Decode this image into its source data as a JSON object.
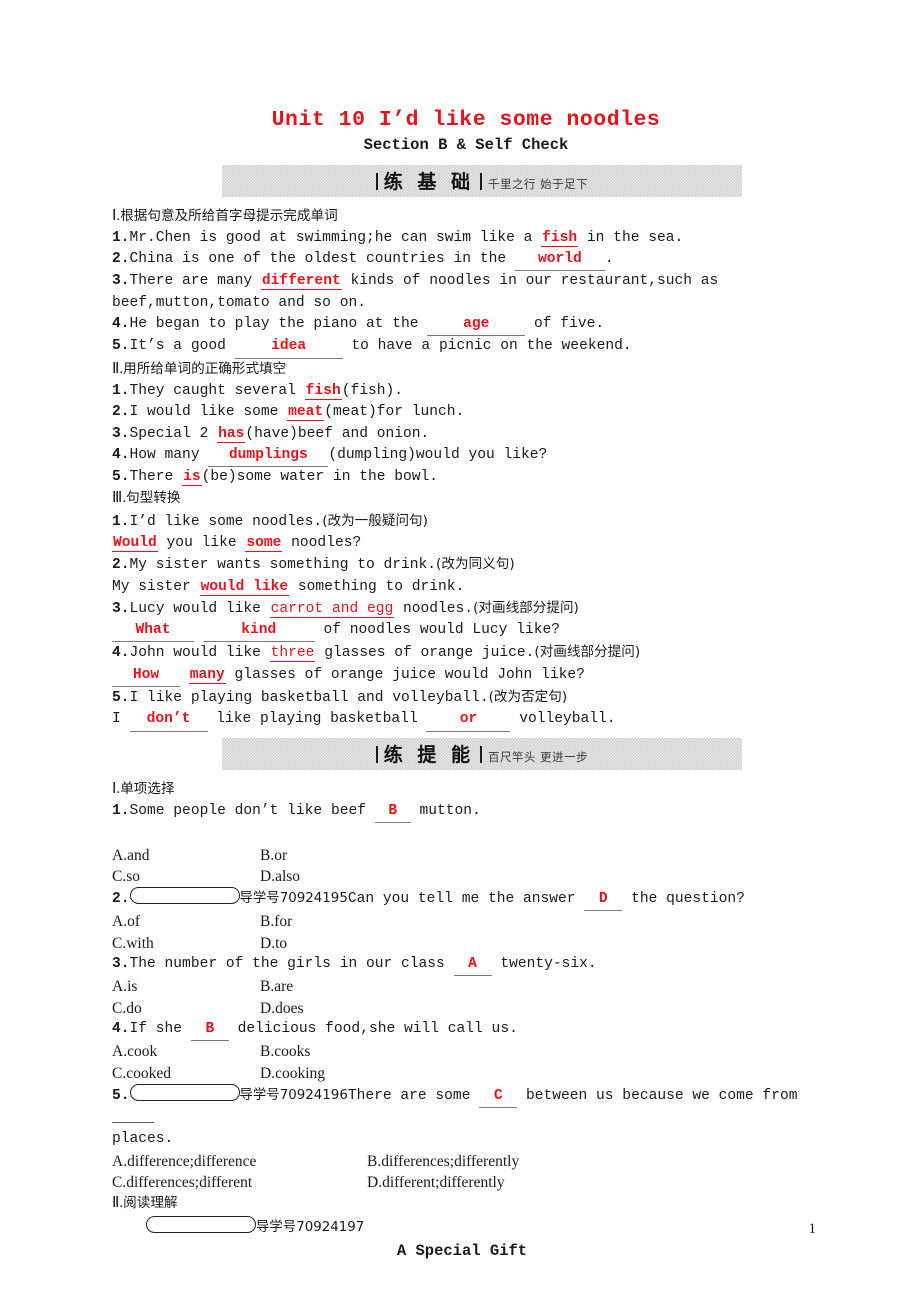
{
  "document": {
    "unit_title": "Unit 10 I’d like some noodles",
    "section_subtitle": "Section B & Self Check",
    "page_number": "1"
  },
  "banners": [
    {
      "bar": "|",
      "main": "练 基 础",
      "divider": "|",
      "motto": "千里之行 始于足下"
    },
    {
      "bar": "|",
      "main": "练 提 能",
      "divider": "|",
      "motto": "百尺竿头 更进一步"
    }
  ],
  "basics": {
    "part1": {
      "heading_roman": "Ⅰ.",
      "heading_cn": "根据句意及所给首字母提示完成单词",
      "items": [
        {
          "num": "1.",
          "pre": "Mr.Chen is good at swimming;he can swim like a ",
          "answer": "fish",
          "post": " in the sea."
        },
        {
          "num": "2.",
          "pre": "China is one of the oldest countries in the ",
          "answer": "world",
          "post": "."
        },
        {
          "num": "3.",
          "pre": "There are many ",
          "answer": "different",
          "post": " kinds of noodles in our restaurant,such as"
        },
        {
          "cont": "beef,mutton,tomato and so on."
        },
        {
          "num": "4.",
          "pre": "He began to play the piano at the ",
          "answer": "age",
          "post": " of five."
        },
        {
          "num": "5.",
          "pre": "It’s a good ",
          "answer": "idea",
          "post": " to have a picnic on the weekend."
        }
      ]
    },
    "part2": {
      "heading_roman": "Ⅱ.",
      "heading_cn": "用所给单词的正确形式填空",
      "items": [
        {
          "num": "1.",
          "pre": "They caught several ",
          "answer": "fish",
          "post": "(fish)."
        },
        {
          "num": "2.",
          "pre": "I would like some ",
          "answer": "meat",
          "post": "(meat)for lunch."
        },
        {
          "num": "3.",
          "pre": "Special 2 ",
          "answer": "has",
          "post": "(have)beef and onion."
        },
        {
          "num": "4.",
          "pre": "How many ",
          "answer": "dumplings",
          "post": "(dumpling)would you like?"
        },
        {
          "num": "5.",
          "pre": "There ",
          "answer": "is",
          "post": "(be)some water in the bowl."
        }
      ]
    },
    "part3": {
      "heading_roman": "Ⅲ.",
      "heading_cn": "句型转换",
      "items": [
        {
          "num": "1.",
          "prompt": "I’d like some noodles.",
          "tag": "(改为一般疑问句)"
        },
        {
          "answer1": "Would",
          "mid1": " you like ",
          "answer2": "some",
          "mid2": " noodles?"
        },
        {
          "num": "2.",
          "prompt": "My sister wants something to drink.",
          "tag": "(改为同义句)"
        },
        {
          "pre": "My sister ",
          "answer1": "would like",
          "post": " something to drink."
        },
        {
          "num": "3.",
          "prompt_pre": "Lucy would like ",
          "underlined": "carrot and egg",
          "prompt_post": " noodles.",
          "tag": "(对画线部分提问)"
        },
        {
          "answer1": "What",
          "answer2": "kind",
          "post": " of noodles would Lucy like?"
        },
        {
          "num": "4.",
          "prompt_pre": "John would like ",
          "underlined": "three",
          "prompt_post": " glasses of orange juice.",
          "tag": "(对画线部分提问)"
        },
        {
          "answer1": "How",
          "answer2": "many",
          "post": " glasses of orange juice would John like?"
        },
        {
          "num": "5.",
          "prompt": "I like playing basketball and volleyball.",
          "tag": "(改为否定句)"
        },
        {
          "pre": "I ",
          "answer1": "don’t",
          "mid": " like playing basketball ",
          "answer2": "or",
          "post": " volleyball."
        }
      ]
    }
  },
  "ability": {
    "part1": {
      "heading_roman": "Ⅰ.",
      "heading_cn": "单项选择",
      "questions": [
        {
          "num": "1.",
          "pill": false,
          "badge_label": "",
          "badge_number": "",
          "stem_pre": "Some people don’t like beef ",
          "answer": "B",
          "stem_post": " mutton.",
          "blank_after": false,
          "spacer": true,
          "options": [
            "A.and",
            "B.or",
            "C.so",
            "D.also"
          ],
          "wide": false
        },
        {
          "num": "2.",
          "pill": true,
          "badge_label": "导学号",
          "badge_number": "70924195",
          "stem_pre": "Can you tell me the answer ",
          "answer": "D",
          "stem_post": " the question?",
          "blank_after": false,
          "spacer": false,
          "options": [
            "A.of",
            "B.for",
            "C.with",
            "D.to"
          ],
          "wide": false
        },
        {
          "num": "3.",
          "pill": false,
          "badge_label": "",
          "badge_number": "",
          "stem_pre": "The number of the girls in our class ",
          "answer": "A",
          "stem_post": " twenty-six.",
          "blank_after": false,
          "spacer": false,
          "options": [
            "A.is",
            "B.are",
            "C.do",
            "D.does"
          ],
          "wide": false
        },
        {
          "num": "4.",
          "pill": false,
          "badge_label": "",
          "badge_number": "",
          "stem_pre": "If she ",
          "answer": "B",
          "stem_post": " delicious food,she will call us.",
          "blank_after": false,
          "spacer": false,
          "options": [
            "A.cook",
            "B.cooks",
            "C.cooked",
            "D.cooking"
          ],
          "wide": false
        },
        {
          "num": "5.",
          "pill": true,
          "badge_label": "导学号",
          "badge_number": "70924196",
          "stem_pre": "There are some ",
          "answer": "C",
          "stem_post": " between us because we come from ",
          "blank_after": true,
          "stem_wrap": "places.",
          "spacer": false,
          "options": [
            "A.difference;difference",
            "B.differences;differently",
            "C.differences;different",
            "D.different;differently"
          ],
          "wide": true
        }
      ]
    },
    "part2": {
      "heading_roman": "Ⅱ.",
      "heading_cn": "阅读理解",
      "badge_label": "导学号",
      "badge_number": "70924197",
      "article_title": "A Special Gift"
    }
  }
}
